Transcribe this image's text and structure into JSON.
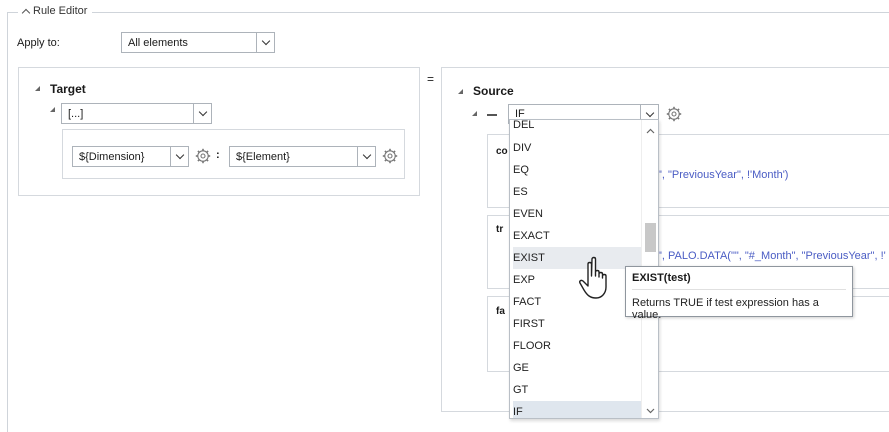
{
  "rule_editor": {
    "title": "Rule Editor"
  },
  "apply_to": {
    "label": "Apply to:",
    "value": "All elements"
  },
  "target": {
    "title": "Target",
    "selector_value": "[...]",
    "dimension_value": "${Dimension}",
    "separator": ":",
    "element_value": "${Element}"
  },
  "equals_sign": "=",
  "source": {
    "title": "Source",
    "function_value": "IF",
    "row1_label": "co",
    "row1_text": "\", \"PreviousYear\", !'Month')",
    "row2_label": "tr",
    "row2_text": "\", PALO.DATA(\"\", \"#_Month\", \"PreviousYear\", !'",
    "row3_label": "fa"
  },
  "dropdown": {
    "items": [
      "DEL",
      "DIV",
      "EQ",
      "ES",
      "EVEN",
      "EXACT",
      "EXIST",
      "EXP",
      "FACT",
      "FIRST",
      "FLOOR",
      "GE",
      "GT",
      "IF"
    ],
    "hovered": "EXIST",
    "selected": "IF"
  },
  "tooltip": {
    "title": "EXIST(test)",
    "description": "Returns TRUE if test expression has a value."
  },
  "colors": {
    "accent_text": "#4a5cc4",
    "hover": "#e8ebef",
    "border": "#d5d9de"
  }
}
